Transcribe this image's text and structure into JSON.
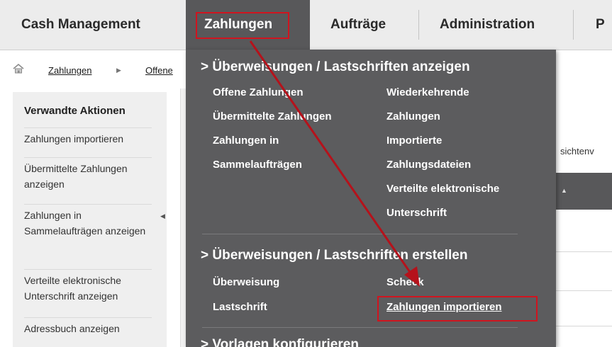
{
  "nav": {
    "items": [
      {
        "label": "Cash Management"
      },
      {
        "label": "Zahlungen"
      },
      {
        "label": "Aufträge"
      },
      {
        "label": "Administration"
      },
      {
        "label": "P"
      }
    ]
  },
  "breadcrumb": {
    "items": [
      "Zahlungen",
      "Offene"
    ]
  },
  "sidebar": {
    "title": "Verwandte Aktionen",
    "items": [
      {
        "label": "Zahlungen importieren"
      },
      {
        "label": "Übermittelte Zahlungen anzeigen"
      },
      {
        "label": "Zahlungen in Sammelaufträgen anzeigen"
      },
      {
        "label": "Verteilte elektronische Unterschrift anzeigen"
      },
      {
        "label": "Adressbuch anzeigen"
      }
    ]
  },
  "right": {
    "partial_text": "sichtenv"
  },
  "dropdown": {
    "section1": {
      "heading": "> Überweisungen / Lastschriften anzeigen",
      "col1": [
        "Offene Zahlungen",
        "Übermittelte Zahlungen",
        "Zahlungen in",
        "Sammelaufträgen"
      ],
      "col2": [
        "Wiederkehrende",
        "Zahlungen",
        "Importierte",
        "Zahlungsdateien",
        "Verteilte elektronische",
        "Unterschrift"
      ]
    },
    "section2": {
      "heading": "> Überweisungen / Lastschriften erstellen",
      "col1": [
        "Überweisung",
        "Lastschrift"
      ],
      "col2": [
        "Scheck",
        "Zahlungen importieren"
      ]
    },
    "section3": {
      "heading": "> Vorlagen konfigurieren"
    }
  },
  "colors": {
    "menu_bg": "#5c5c5e",
    "highlight": "#d0141f",
    "nav_bg": "#ececec"
  }
}
